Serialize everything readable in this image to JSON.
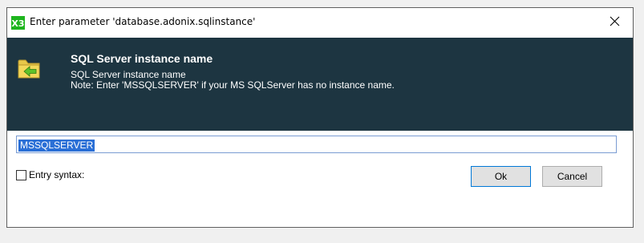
{
  "window": {
    "title": "Enter parameter 'database.adonix.sqlinstance'",
    "app_icon": "x3-icon",
    "close_icon": "close-icon"
  },
  "header": {
    "icon": "folder-arrow-icon",
    "title": "SQL Server instance name",
    "description": "SQL Server instance name",
    "note": "Note: Enter 'MSSQLSERVER' if your MS SQLServer has no instance name."
  },
  "input": {
    "value": "MSSQLSERVER",
    "selected": true
  },
  "entry_syntax": {
    "label": "Entry syntax:",
    "checked": false
  },
  "buttons": {
    "ok_label": "Ok",
    "cancel_label": "Cancel"
  },
  "colors": {
    "header_bg": "#1d3541",
    "selection": "#2a6fd6",
    "app_icon_green": "#1fb51f"
  }
}
